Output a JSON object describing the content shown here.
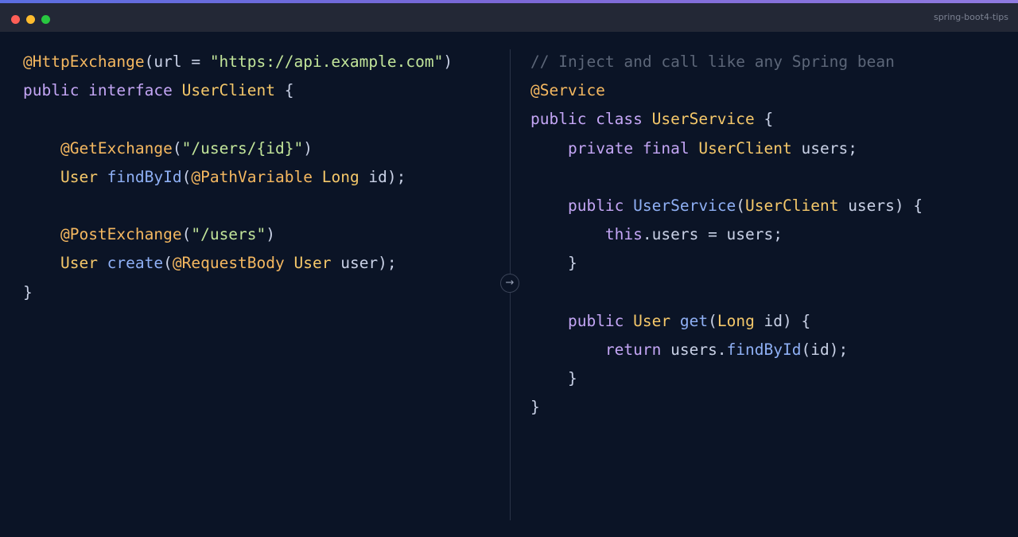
{
  "window": {
    "title": "spring-boot4-tips",
    "accent_color": "#7b68d6",
    "background_color": "#0b1426"
  },
  "divider": {
    "arrow_icon": "→"
  },
  "token_colors": {
    "annotation": "#f5b860",
    "keyword": "#c4a6f5",
    "type": "#f5c86a",
    "function": "#8fb0f5",
    "string": "#c2e59a",
    "comment": "#5c6678",
    "plain": "#c9d1e6"
  },
  "left_code": {
    "lines": [
      [
        [
          "ann",
          "@HttpExchange"
        ],
        [
          "punc",
          "(url = "
        ],
        [
          "str",
          "\"https://api.example.com\""
        ],
        [
          "punc",
          ")"
        ]
      ],
      [
        [
          "kw",
          "public interface "
        ],
        [
          "type",
          "UserClient"
        ],
        [
          "punc",
          " {"
        ]
      ],
      [],
      [
        [
          "plain",
          "    "
        ],
        [
          "ann",
          "@GetExchange"
        ],
        [
          "punc",
          "("
        ],
        [
          "str",
          "\"/users/{id}\""
        ],
        [
          "punc",
          ")"
        ]
      ],
      [
        [
          "plain",
          "    "
        ],
        [
          "type",
          "User "
        ],
        [
          "fn",
          "findById"
        ],
        [
          "punc",
          "("
        ],
        [
          "ann",
          "@PathVariable "
        ],
        [
          "type",
          "Long"
        ],
        [
          "plain",
          " id);"
        ]
      ],
      [],
      [
        [
          "plain",
          "    "
        ],
        [
          "ann",
          "@PostExchange"
        ],
        [
          "punc",
          "("
        ],
        [
          "str",
          "\"/users\""
        ],
        [
          "punc",
          ")"
        ]
      ],
      [
        [
          "plain",
          "    "
        ],
        [
          "type",
          "User "
        ],
        [
          "fn",
          "create"
        ],
        [
          "punc",
          "("
        ],
        [
          "ann",
          "@RequestBody "
        ],
        [
          "type",
          "User"
        ],
        [
          "plain",
          " user);"
        ]
      ],
      [
        [
          "punc",
          "}"
        ]
      ]
    ]
  },
  "right_code": {
    "lines": [
      [
        [
          "cmt",
          "// Inject and call like any Spring bean"
        ]
      ],
      [
        [
          "ann",
          "@Service"
        ]
      ],
      [
        [
          "kw",
          "public class "
        ],
        [
          "type",
          "UserService"
        ],
        [
          "punc",
          " {"
        ]
      ],
      [
        [
          "plain",
          "    "
        ],
        [
          "kw",
          "private final "
        ],
        [
          "type",
          "UserClient"
        ],
        [
          "plain",
          " users;"
        ]
      ],
      [],
      [
        [
          "plain",
          "    "
        ],
        [
          "kw",
          "public "
        ],
        [
          "fn",
          "UserService"
        ],
        [
          "punc",
          "("
        ],
        [
          "type",
          "UserClient"
        ],
        [
          "plain",
          " users) {"
        ]
      ],
      [
        [
          "plain",
          "        "
        ],
        [
          "kw",
          "this"
        ],
        [
          "plain",
          ".users = users;"
        ]
      ],
      [
        [
          "plain",
          "    }"
        ]
      ],
      [],
      [
        [
          "plain",
          "    "
        ],
        [
          "kw",
          "public "
        ],
        [
          "type",
          "User "
        ],
        [
          "fn",
          "get"
        ],
        [
          "punc",
          "("
        ],
        [
          "type",
          "Long"
        ],
        [
          "plain",
          " id) {"
        ]
      ],
      [
        [
          "plain",
          "        "
        ],
        [
          "kw",
          "return "
        ],
        [
          "plain",
          "users."
        ],
        [
          "fn",
          "findById"
        ],
        [
          "plain",
          "(id);"
        ]
      ],
      [
        [
          "plain",
          "    }"
        ]
      ],
      [
        [
          "punc",
          "}"
        ]
      ]
    ]
  }
}
